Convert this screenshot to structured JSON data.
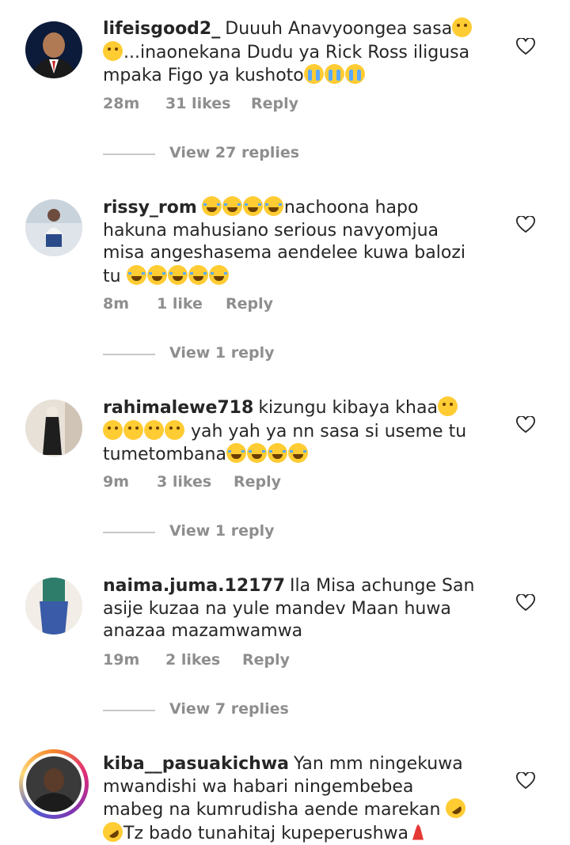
{
  "comments": [
    {
      "username": "lifeisgood2_",
      "segments": [
        {
          "t": "Duuuh Anavyoongea sasa"
        },
        {
          "e": "cry"
        },
        {
          "e": "cry"
        },
        {
          "t": "...inaonekana Dudu ya Rick Ross iligusa mpaka Figo ya kushoto"
        },
        {
          "e": "sob"
        },
        {
          "e": "sob"
        },
        {
          "e": "sob"
        }
      ],
      "time": "28m",
      "likes": "31 likes",
      "reply": "Reply",
      "view_replies": "View 27 replies",
      "avatar_icon": "avatar-man-suit"
    },
    {
      "username": "rissy_rom",
      "segments": [
        {
          "e": "laugh"
        },
        {
          "e": "laugh"
        },
        {
          "e": "laugh"
        },
        {
          "e": "laugh"
        },
        {
          "t": "nachoona hapo hakuna mahusiano serious navyomjua misa angeshasema aendelee kuwa balozi tu "
        },
        {
          "e": "laugh"
        },
        {
          "e": "laugh"
        },
        {
          "e": "laugh"
        },
        {
          "e": "laugh"
        },
        {
          "e": "laugh"
        }
      ],
      "time": "8m",
      "likes": "1 like",
      "reply": "Reply",
      "view_replies": "View 1 reply",
      "avatar_icon": "avatar-person-sitting"
    },
    {
      "username": "rahimalewe718",
      "segments": [
        {
          "t": "kizungu kibaya khaa"
        },
        {
          "e": "cry"
        },
        {
          "e": "cry"
        },
        {
          "e": "cry"
        },
        {
          "e": "cry"
        },
        {
          "e": "cry"
        },
        {
          "t": " yah yah ya nn sasa si useme tu tumetombana"
        },
        {
          "e": "laugh"
        },
        {
          "e": "laugh"
        },
        {
          "e": "laugh"
        },
        {
          "e": "laugh"
        }
      ],
      "time": "9m",
      "likes": "3 likes",
      "reply": "Reply",
      "view_replies": "View 1 reply",
      "avatar_icon": "avatar-woman-hijab"
    },
    {
      "username": "naima.juma.12177",
      "segments": [
        {
          "t": "Ila Misa achunge San asije kuzaa na yule mandev Maan huwa anazaa mazamwamwa"
        }
      ],
      "time": "19m",
      "likes": "2 likes",
      "reply": "Reply",
      "view_replies": "View 7 replies",
      "avatar_icon": "avatar-jeans"
    },
    {
      "username": "kiba__pasuakichwa",
      "segments": [
        {
          "t": "Yan mm ningekuwa mwandishi wa habari ningembebea mabeg na kumrudisha  aende marekan "
        },
        {
          "e": "rofl"
        },
        {
          "e": "rofl"
        },
        {
          "t": "Tz bado tunahitaj kupeperushwa"
        },
        {
          "e": "dancer"
        }
      ],
      "avatar_icon": "avatar-man-story"
    }
  ],
  "colors": {
    "text": "#262626",
    "muted": "#8e8e8e",
    "divider": "#c7c7c7"
  }
}
